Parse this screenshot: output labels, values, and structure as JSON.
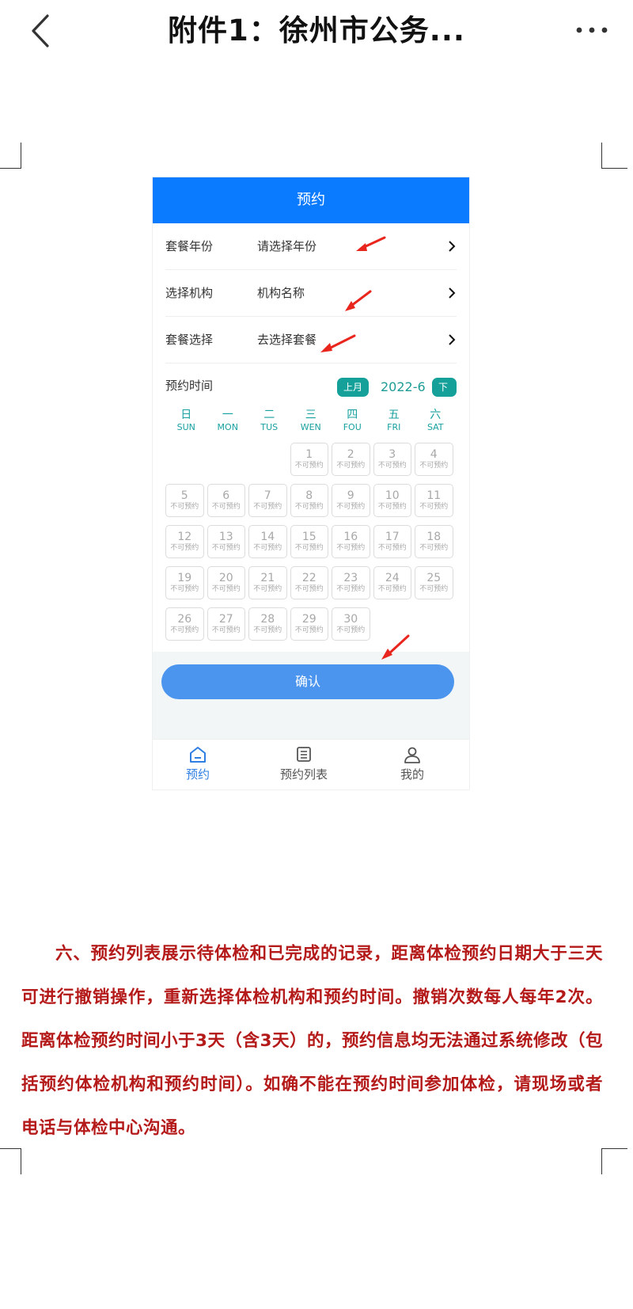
{
  "doc_title": "附件1：徐州市公务...",
  "screenshot": {
    "header_title": "预约",
    "rows": [
      {
        "label": "套餐年份",
        "value": "请选择年份"
      },
      {
        "label": "选择机构",
        "value": "机构名称"
      },
      {
        "label": "套餐选择",
        "value": "去选择套餐"
      }
    ],
    "time_label": "预约时间",
    "prev_month": "上月",
    "month": "2022-6",
    "next_month": "下月",
    "weekdays": [
      {
        "cn": "日",
        "en": "SUN"
      },
      {
        "cn": "一",
        "en": "MON"
      },
      {
        "cn": "二",
        "en": "TUS"
      },
      {
        "cn": "三",
        "en": "WEN"
      },
      {
        "cn": "四",
        "en": "FOU"
      },
      {
        "cn": "五",
        "en": "FRI"
      },
      {
        "cn": "六",
        "en": "SAT"
      }
    ],
    "leading_blank_days": 3,
    "day_count": 30,
    "day_status": "不可预约",
    "confirm_label": "确认",
    "tabs": [
      {
        "label": "预约",
        "icon": "home-icon",
        "active": true
      },
      {
        "label": "预约列表",
        "icon": "list-icon",
        "active": false
      },
      {
        "label": "我的",
        "icon": "user-icon",
        "active": false
      }
    ]
  },
  "paragraph": "六、预约列表展示待体检和已完成的记录，距离体检预约日期大于三天可进行撤销操作，重新选择体检机构和预约时间。撤销次数每人每年2次。距离体检预约时间小于3天（含3天）的，预约信息均无法通过系统修改（包括预约体检机构和预约时间）。如确不能在预约时间参加体检，请现场或者电话与体检中心沟通。",
  "colors": {
    "header_blue": "#0a7aff",
    "teal": "#15a19a",
    "confirm_blue": "#4b95ee",
    "paragraph_red": "#b51a1a",
    "arrow_red": "#e8261e"
  }
}
